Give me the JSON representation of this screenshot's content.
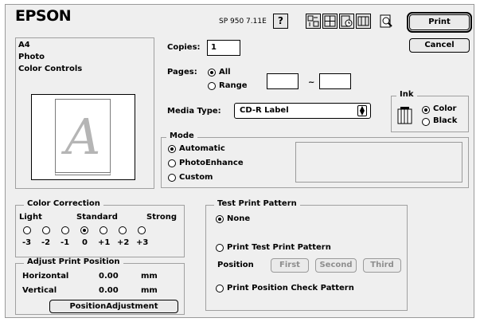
{
  "header": {
    "brand": "EPSON",
    "version": "SP 950 7.11E",
    "help_label": "?",
    "print_label": "Print",
    "cancel_label": "Cancel"
  },
  "summary": {
    "paper": "A4",
    "type": "Photo",
    "color": "Color Controls"
  },
  "preview": {
    "letter": "A"
  },
  "copies": {
    "label": "Copies:",
    "value": "1"
  },
  "pages": {
    "label": "Pages:",
    "all_label": "All",
    "range_label": "Range",
    "separator": "~",
    "from": "",
    "to": "",
    "selected": "All"
  },
  "media": {
    "label": "Media Type:",
    "value": "CD-R Label"
  },
  "ink": {
    "title": "Ink",
    "color_label": "Color",
    "black_label": "Black",
    "selected": "Color"
  },
  "mode": {
    "title": "Mode",
    "options": [
      "Automatic",
      "PhotoEnhance",
      "Custom"
    ],
    "selected": "Automatic"
  },
  "color_correction": {
    "title": "Color Correction",
    "left": "Light",
    "center": "Standard",
    "right": "Strong",
    "levels": [
      "-3",
      "-2",
      "-1",
      "0",
      "+1",
      "+2",
      "+3"
    ],
    "selected": "0"
  },
  "adjust": {
    "title": "Adjust Print Position",
    "horizontal_label": "Horizontal",
    "horizontal_value": "0.00",
    "vertical_label": "Vertical",
    "vertical_value": "0.00",
    "unit": "mm",
    "button_label": "PositionAdjustment"
  },
  "test": {
    "title": "Test Print Pattern",
    "none_label": "None",
    "print_label": "Print Test Print Pattern",
    "position_label": "Position",
    "first": "First",
    "second": "Second",
    "third": "Third",
    "check_label": "Print Position Check Pattern",
    "selected": "None"
  }
}
